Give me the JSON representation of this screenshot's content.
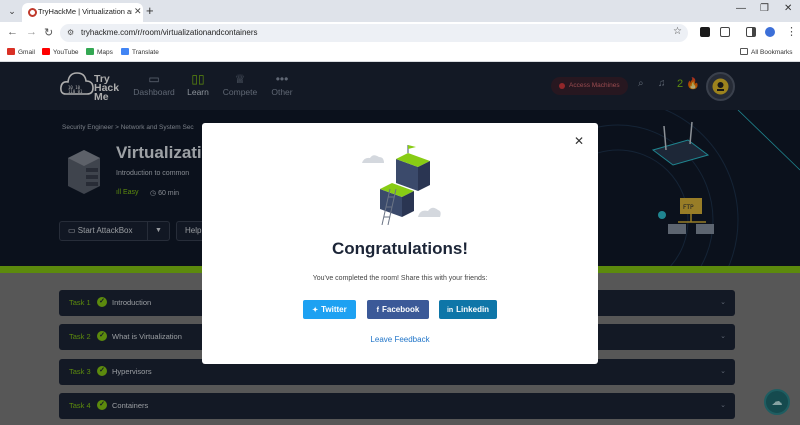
{
  "browser": {
    "tab_title": "TryHackMe | Virtualization and",
    "url": "tryhackme.com/r/room/virtualizationandcontainers",
    "bookmarks": [
      "Gmail",
      "YouTube",
      "Maps",
      "Translate"
    ],
    "all_bookmarks": "All Bookmarks"
  },
  "header": {
    "logo_lines": [
      "Try",
      "Hack",
      "Me"
    ],
    "nav": [
      {
        "label": "Dashboard"
      },
      {
        "label": "Learn"
      },
      {
        "label": "Compete"
      },
      {
        "label": "Other"
      }
    ],
    "access_machines": "Access Machines",
    "streak": "2"
  },
  "room": {
    "breadcrumb": "Security Engineer > Network and System Sec",
    "title": "Virtualizati",
    "subtitle": "Introduction to common",
    "difficulty": "Easy",
    "duration": "60 min",
    "start_attackbox": "Start AttackBox",
    "help": "Help"
  },
  "tasks": [
    {
      "num": "Task 1",
      "title": "Introduction"
    },
    {
      "num": "Task 2",
      "title": "What is Virtualization"
    },
    {
      "num": "Task 3",
      "title": "Hypervisors"
    },
    {
      "num": "Task 4",
      "title": "Containers"
    }
  ],
  "modal": {
    "title": "Congratulations!",
    "message": "You've completed the room! Share this with your friends:",
    "twitter": "Twitter",
    "facebook": "Facebook",
    "linkedin": "Linkedin",
    "feedback": "Leave Feedback"
  },
  "colors": {
    "accent": "#88cc14",
    "header_bg": "#1c2537",
    "twitter": "#1da1f2",
    "facebook": "#3b5998",
    "linkedin": "#0e76a8"
  }
}
